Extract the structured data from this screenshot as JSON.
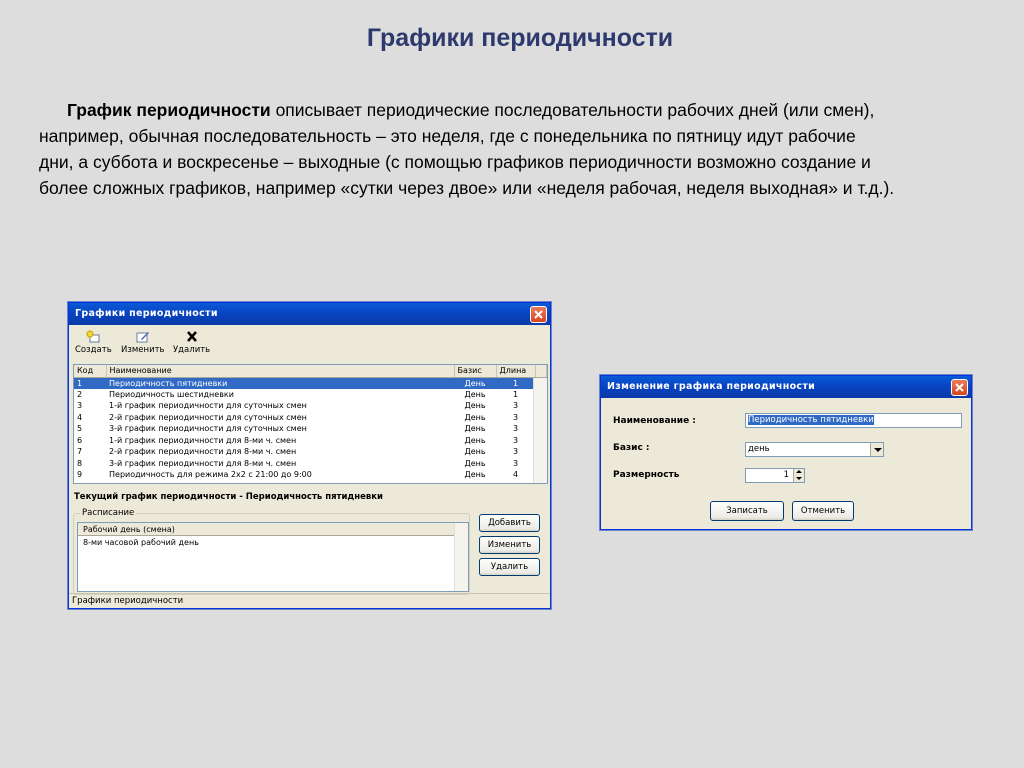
{
  "slide": {
    "title": "Графики периодичности",
    "paragraph": {
      "bold_lead": "График периодичности",
      "line1_rest": " описывает периодические последовательности рабочих дней (или смен),",
      "line2": "например, обычная последовательность – это неделя, где с понедельника по пятницу идут рабочие",
      "line3": "дни, а суббота и воскресенье – выходные (с помощью графиков периодичности возможно создание и",
      "line4": "более сложных графиков, например «сутки через двое» или «неделя рабочая, неделя выходная» и т.д.)."
    }
  },
  "main_window": {
    "title": "Графики периодичности",
    "toolbar": {
      "create": {
        "label": "Создать",
        "icon": "new-item-icon"
      },
      "edit": {
        "label": "Изменить",
        "icon": "edit-pencil-icon"
      },
      "delete": {
        "label": "Удалить",
        "icon": "delete-x-icon"
      }
    },
    "table": {
      "columns": [
        "Код",
        "Наименование",
        "Базис",
        "Длина"
      ],
      "rows": [
        {
          "code": "1",
          "name": "Периодичность пятидневки",
          "basis": "День",
          "length": "1",
          "selected": true
        },
        {
          "code": "2",
          "name": "Периодичность шестидневки",
          "basis": "День",
          "length": "1"
        },
        {
          "code": "3",
          "name": "1-й график периодичности для суточных смен",
          "basis": "День",
          "length": "3"
        },
        {
          "code": "4",
          "name": "2-й график периодичности для суточных смен",
          "basis": "День",
          "length": "3"
        },
        {
          "code": "5",
          "name": "3-й график периодичности для суточных смен",
          "basis": "День",
          "length": "3"
        },
        {
          "code": "6",
          "name": "1-й график периодичности для 8-ми ч. смен",
          "basis": "День",
          "length": "3"
        },
        {
          "code": "7",
          "name": "2-й график периодичности для 8-ми ч. смен",
          "basis": "День",
          "length": "3"
        },
        {
          "code": "8",
          "name": "3-й график периодичности для 8-ми ч. смен",
          "basis": "День",
          "length": "3"
        },
        {
          "code": "9",
          "name": "Периодичность для режима 2х2 с 21:00 до 9:00",
          "basis": "День",
          "length": "4"
        }
      ]
    },
    "current_label": "Текущий график периодичности - Периодичность пятидневки",
    "schedule": {
      "group_label": "Расписание",
      "column": "Рабочий день (смена)",
      "rows": [
        "8-ми часовой рабочий день"
      ]
    },
    "buttons": {
      "add": "Добавить",
      "edit": "Изменить",
      "delete": "Удалить"
    },
    "status": "Графики периодичности"
  },
  "edit_dialog": {
    "title": "Изменение графика периодичности",
    "name_label": "Наименование :",
    "name_value": "Периодичность пятидневки",
    "basis_label": "Базис :",
    "basis_value": "день",
    "size_label": "Размерность",
    "size_value": "1",
    "save": "Записать",
    "cancel": "Отменить"
  },
  "colors": {
    "title_blue": "#2e3a6e",
    "background": "#dddddd",
    "xp_titlebar": "#0a5ad6",
    "selection": "#316ac5"
  }
}
